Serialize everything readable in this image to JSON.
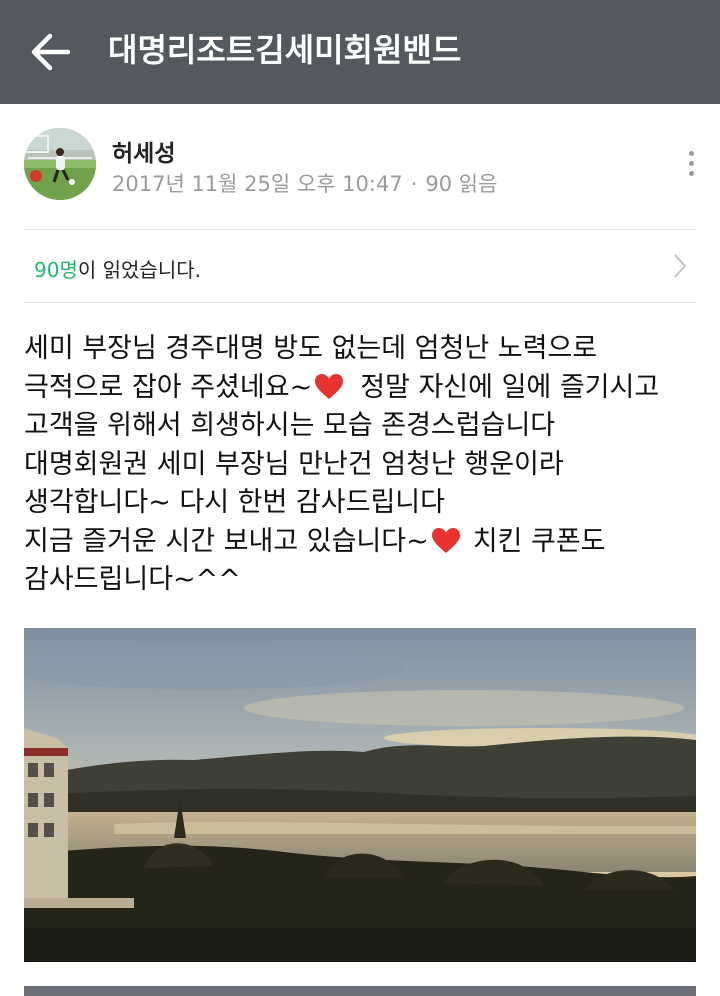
{
  "header": {
    "back_icon": "arrow-left-icon",
    "title": "대명리조트김세미회원밴드",
    "background": "#54595f"
  },
  "post": {
    "author": "허세성",
    "date": "2017년 11월 25일 오후 10:47",
    "separator": "·",
    "read_count": "90 읽음",
    "more_icon": "more-vertical-icon",
    "readers": {
      "count": "90명",
      "suffix": "이 읽었습니다.",
      "count_color": "#1dbb69",
      "chevron_icon": "chevron-right-icon"
    },
    "body_lines": [
      "세미 부장님 경주대명 방도 없는데 엄청난 노력으로",
      "극적으로 잡아 주셨네요~",
      "정말 자신에 일에 즐기시고",
      "고객을 위해서 희생하시는 모습 존경스럽습니다",
      "대명회원권 세미 부장님 만난건 엄청난 행운이라",
      "생각합니다~ 다시 한번 감사드립니다",
      "지금 즐거운 시간 보내고 있습니다~",
      "치킨 쿠폰도",
      "감사드립니다~^^"
    ],
    "heart_icon": "red-heart-icon"
  }
}
